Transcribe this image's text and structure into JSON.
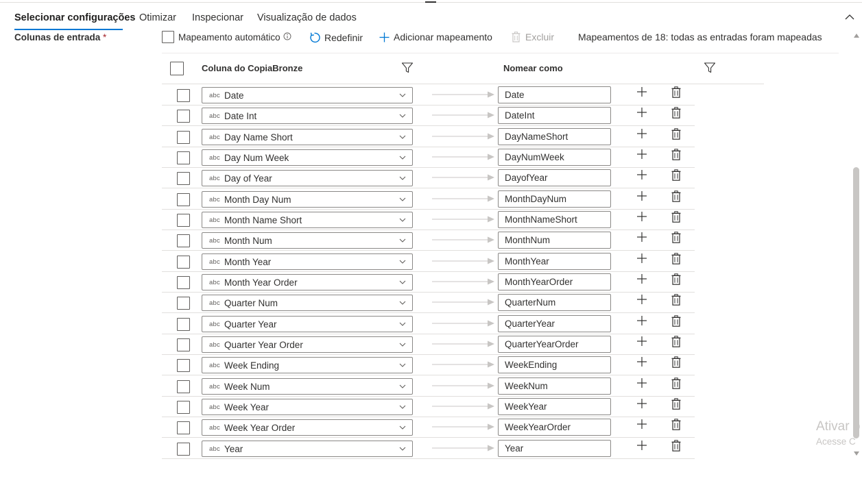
{
  "tabs": [
    {
      "label": "Selecionar configurações",
      "active": true
    },
    {
      "label": "Otimizar",
      "active": false
    },
    {
      "label": "Inspecionar",
      "active": false
    },
    {
      "label": "Visualização de dados",
      "active": false
    }
  ],
  "section": {
    "label": "Colunas de entrada",
    "required_mark": "*"
  },
  "toolbar": {
    "auto_mapping_label": "Mapeamento automático",
    "auto_mapping_checked": false,
    "reset_label": "Redefinir",
    "add_mapping_label": "Adicionar mapeamento",
    "delete_label": "Excluir",
    "status_text": "Mapeamentos de 18: todas as entradas foram mapeadas"
  },
  "table": {
    "source_header": "Coluna do CopiaBronze",
    "target_header": "Nomear como",
    "type_tag": "abc",
    "rows": [
      {
        "source": "Date",
        "target": "Date"
      },
      {
        "source": "Date Int",
        "target": "DateInt"
      },
      {
        "source": "Day Name Short",
        "target": "DayNameShort"
      },
      {
        "source": "Day Num Week",
        "target": "DayNumWeek"
      },
      {
        "source": "Day of Year",
        "target": "DayofYear"
      },
      {
        "source": "Month Day Num",
        "target": "MonthDayNum"
      },
      {
        "source": "Month Name Short",
        "target": "MonthNameShort"
      },
      {
        "source": "Month Num",
        "target": "MonthNum"
      },
      {
        "source": "Month Year",
        "target": "MonthYear"
      },
      {
        "source": "Month Year Order",
        "target": "MonthYearOrder"
      },
      {
        "source": "Quarter Num",
        "target": "QuarterNum"
      },
      {
        "source": "Quarter Year",
        "target": "QuarterYear"
      },
      {
        "source": "Quarter Year Order",
        "target": "QuarterYearOrder"
      },
      {
        "source": "Week Ending",
        "target": "WeekEnding"
      },
      {
        "source": "Week Num",
        "target": "WeekNum"
      },
      {
        "source": "Week Year",
        "target": "WeekYear"
      },
      {
        "source": "Week Year Order",
        "target": "WeekYearOrder"
      },
      {
        "source": "Year",
        "target": "Year"
      }
    ]
  },
  "watermark": {
    "line1": "Ativar o",
    "line2": "Acesse C"
  },
  "colors": {
    "accent": "#0078d4",
    "required": "#a4262c",
    "border": "#8a8886",
    "divider": "#e1dfdd"
  },
  "icons": [
    "info-icon",
    "refresh-icon",
    "plus-icon",
    "trash-icon",
    "filter-icon",
    "chevron-down-icon",
    "chevron-up-icon",
    "arrow-right-icon"
  ]
}
